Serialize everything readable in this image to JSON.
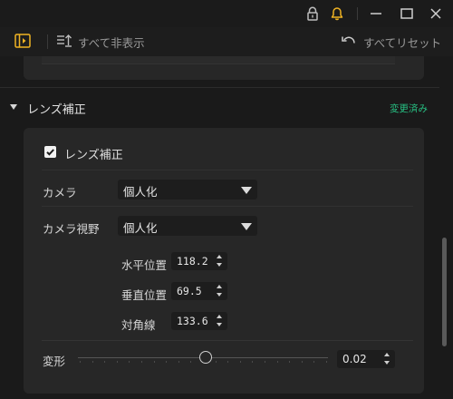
{
  "toolbar": {
    "hide_all_label": "すべて非表示",
    "reset_all_label": "すべてリセット"
  },
  "section": {
    "title": "レンズ補正",
    "status": "変更済み"
  },
  "lens": {
    "checkbox_label": "レンズ補正",
    "checked": true
  },
  "camera": {
    "label": "カメラ",
    "value": "個人化"
  },
  "camera_fov": {
    "label": "カメラ視野",
    "value": "個人化"
  },
  "fields": [
    {
      "label": "水平位置",
      "value": "118.2"
    },
    {
      "label": "垂直位置",
      "value": "69.5"
    },
    {
      "label": "対角線",
      "value": "133.6"
    }
  ],
  "transform": {
    "label": "変形",
    "value": "0.02"
  },
  "icons": [
    "lock-icon",
    "bell-icon",
    "minimize-icon",
    "maximize-icon",
    "close-icon",
    "sidebar-toggle-icon",
    "hide-all-icon",
    "undo-icon",
    "checkmark-icon"
  ],
  "colors": {
    "accent_yellow": "#f0b323",
    "accent_green": "#27c083",
    "background": "#1a1a1a",
    "panel": "#272727"
  }
}
